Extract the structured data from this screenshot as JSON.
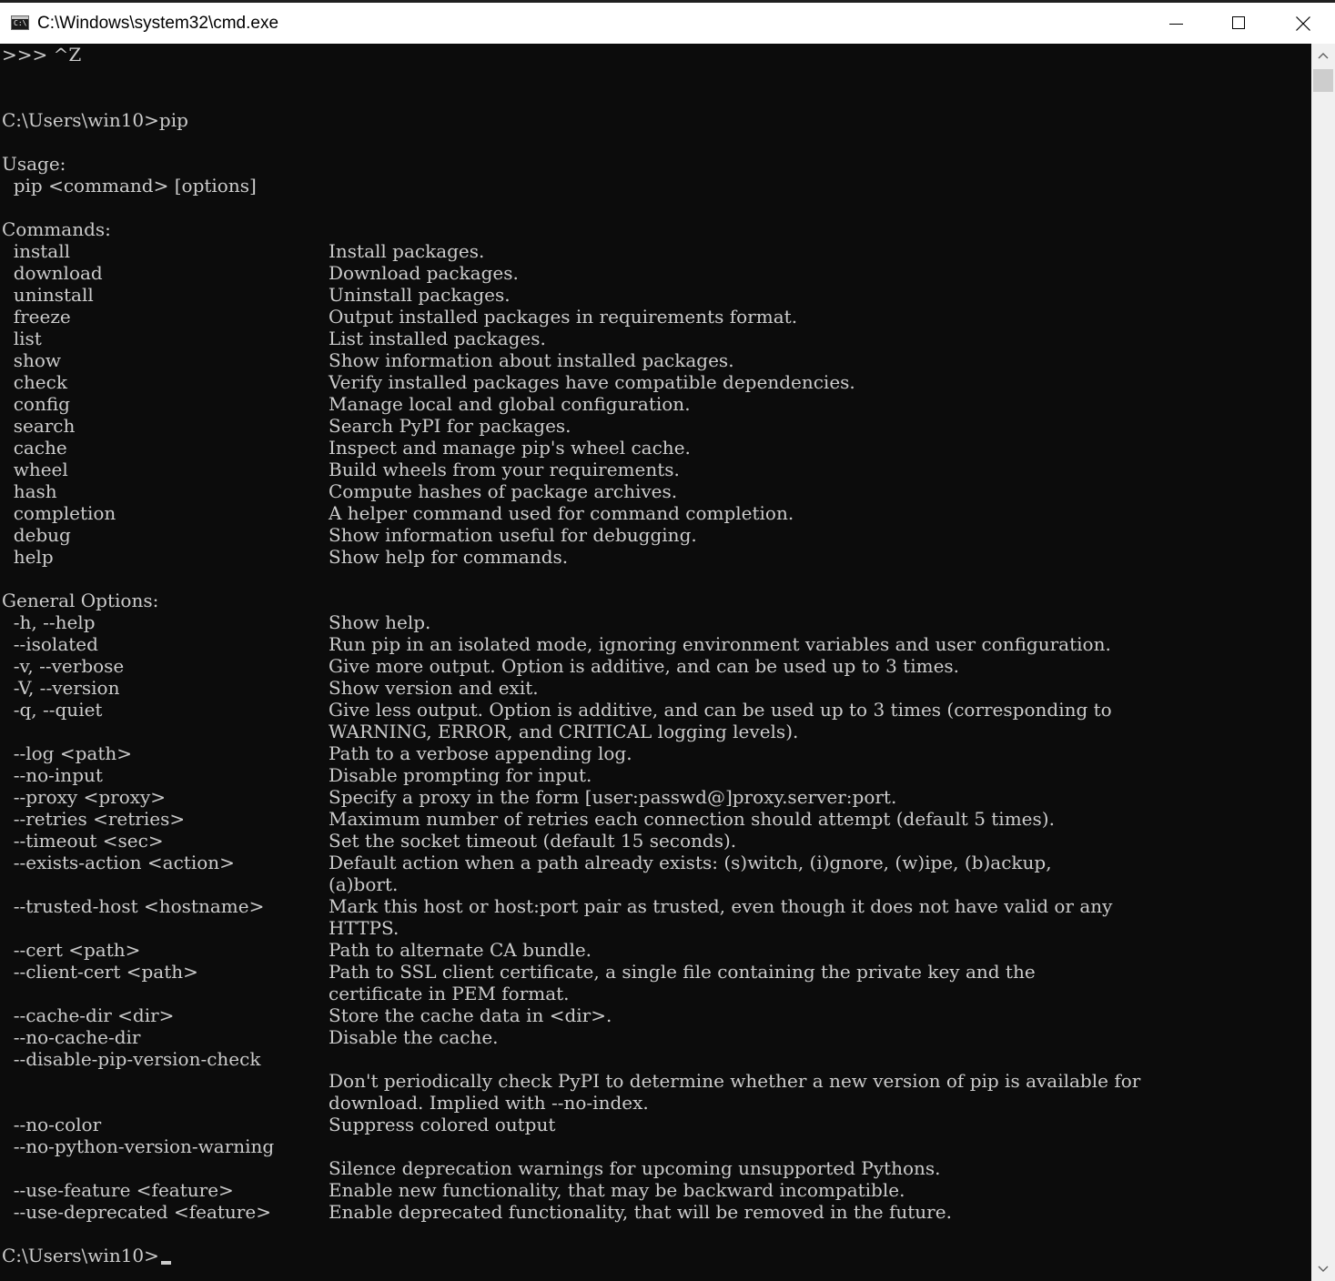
{
  "window": {
    "title": "C:\\Windows\\system32\\cmd.exe",
    "icon_label": "C:\\"
  },
  "controls": {
    "minimize": "minimize-icon",
    "maximize": "maximize-icon",
    "close": "close-icon"
  },
  "colors": {
    "console_background": "#0c0c0c",
    "console_text": "#cccccc",
    "titlebar": "#ffffff"
  },
  "console": {
    "lines": [
      {
        "t": ">>> ^Z"
      },
      {
        "t": ""
      },
      {
        "t": ""
      },
      {
        "t": "C:\\Users\\win10>pip"
      },
      {
        "t": ""
      },
      {
        "t": "Usage:"
      },
      {
        "t": "  pip <command> [options]"
      },
      {
        "t": ""
      },
      {
        "t": "Commands:"
      },
      {
        "t": "  install",
        "d": "Install packages."
      },
      {
        "t": "  download",
        "d": "Download packages."
      },
      {
        "t": "  uninstall",
        "d": "Uninstall packages."
      },
      {
        "t": "  freeze",
        "d": "Output installed packages in requirements format."
      },
      {
        "t": "  list",
        "d": "List installed packages."
      },
      {
        "t": "  show",
        "d": "Show information about installed packages."
      },
      {
        "t": "  check",
        "d": "Verify installed packages have compatible dependencies."
      },
      {
        "t": "  config",
        "d": "Manage local and global configuration."
      },
      {
        "t": "  search",
        "d": "Search PyPI for packages."
      },
      {
        "t": "  cache",
        "d": "Inspect and manage pip's wheel cache."
      },
      {
        "t": "  wheel",
        "d": "Build wheels from your requirements."
      },
      {
        "t": "  hash",
        "d": "Compute hashes of package archives."
      },
      {
        "t": "  completion",
        "d": "A helper command used for command completion."
      },
      {
        "t": "  debug",
        "d": "Show information useful for debugging."
      },
      {
        "t": "  help",
        "d": "Show help for commands."
      },
      {
        "t": ""
      },
      {
        "t": "General Options:"
      },
      {
        "t": "  -h, --help",
        "d": "Show help."
      },
      {
        "t": "  --isolated",
        "d": "Run pip in an isolated mode, ignoring environment variables and user configuration."
      },
      {
        "t": "  -v, --verbose",
        "d": "Give more output. Option is additive, and can be used up to 3 times."
      },
      {
        "t": "  -V, --version",
        "d": "Show version and exit."
      },
      {
        "t": "  -q, --quiet",
        "d": "Give less output. Option is additive, and can be used up to 3 times (corresponding to"
      },
      {
        "t": "",
        "d": "WARNING, ERROR, and CRITICAL logging levels)."
      },
      {
        "t": "  --log <path>",
        "d": "Path to a verbose appending log."
      },
      {
        "t": "  --no-input",
        "d": "Disable prompting for input."
      },
      {
        "t": "  --proxy <proxy>",
        "d": "Specify a proxy in the form [user:passwd@]proxy.server:port."
      },
      {
        "t": "  --retries <retries>",
        "d": "Maximum number of retries each connection should attempt (default 5 times)."
      },
      {
        "t": "  --timeout <sec>",
        "d": "Set the socket timeout (default 15 seconds)."
      },
      {
        "t": "  --exists-action <action>",
        "d": "Default action when a path already exists: (s)witch, (i)gnore, (w)ipe, (b)ackup,"
      },
      {
        "t": "",
        "d": "(a)bort."
      },
      {
        "t": "  --trusted-host <hostname>",
        "d": "Mark this host or host:port pair as trusted, even though it does not have valid or any"
      },
      {
        "t": "",
        "d": "HTTPS."
      },
      {
        "t": "  --cert <path>",
        "d": "Path to alternate CA bundle."
      },
      {
        "t": "  --client-cert <path>",
        "d": "Path to SSL client certificate, a single file containing the private key and the"
      },
      {
        "t": "",
        "d": "certificate in PEM format."
      },
      {
        "t": "  --cache-dir <dir>",
        "d": "Store the cache data in <dir>."
      },
      {
        "t": "  --no-cache-dir",
        "d": "Disable the cache."
      },
      {
        "t": "  --disable-pip-version-check"
      },
      {
        "t": "",
        "d": "Don't periodically check PyPI to determine whether a new version of pip is available for"
      },
      {
        "t": "",
        "d": "download. Implied with --no-index."
      },
      {
        "t": "  --no-color",
        "d": "Suppress colored output"
      },
      {
        "t": "  --no-python-version-warning"
      },
      {
        "t": "",
        "d": "Silence deprecation warnings for upcoming unsupported Pythons."
      },
      {
        "t": "  --use-feature <feature>",
        "d": "Enable new functionality, that may be backward incompatible."
      },
      {
        "t": "  --use-deprecated <feature>",
        "d": "Enable deprecated functionality, that will be removed in the future."
      },
      {
        "t": ""
      },
      {
        "t": "C:\\Users\\win10>",
        "cursor": true
      }
    ]
  },
  "scrollbar": {
    "up": "chevron-up-icon",
    "down": "chevron-down-icon",
    "position": 0
  }
}
